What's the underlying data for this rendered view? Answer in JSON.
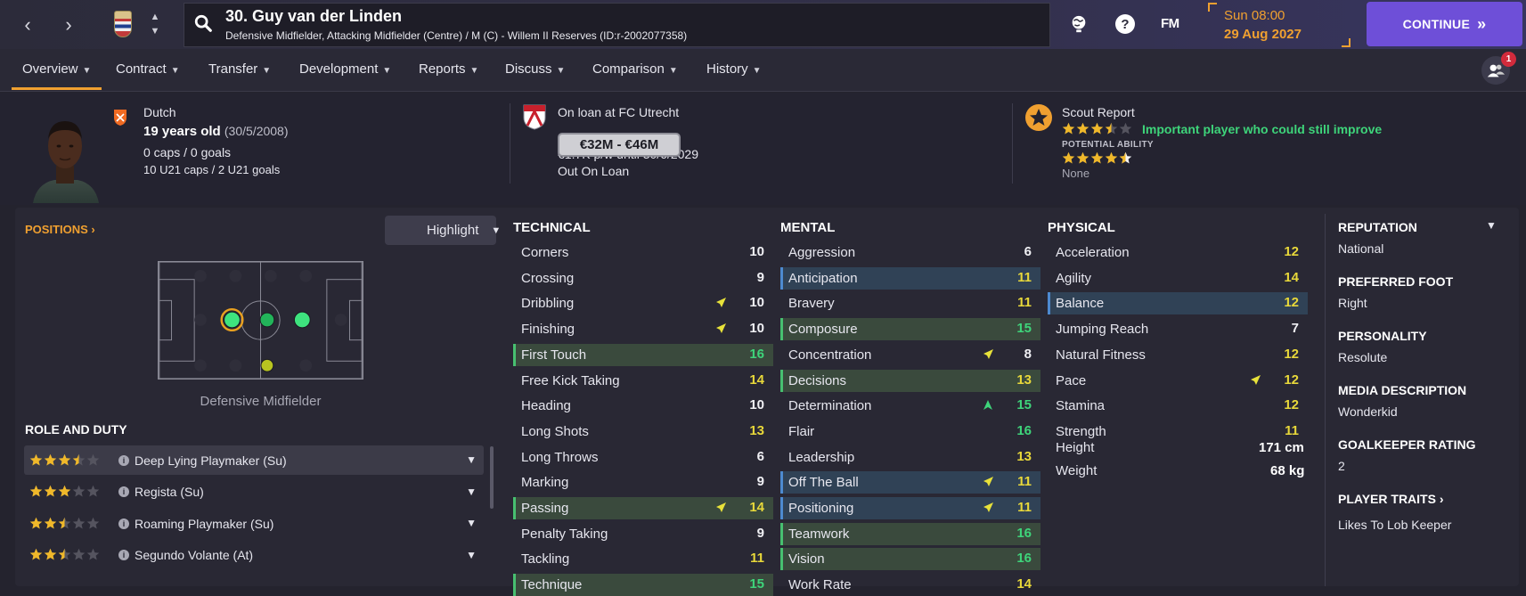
{
  "player": {
    "title": "30. Guy van der Linden",
    "subtitle": "Defensive Midfielder, Attacking Midfielder (Centre) / M (C) - Willem II Reserves (ID:r-2002077358)"
  },
  "topbar": {
    "fm_label": "FM",
    "date_day": "Sun 08:00",
    "date_full": "29 Aug 2027",
    "continue_label": "CONTINUE",
    "accent": "#f0a030",
    "continue_color": "#6e4fd8"
  },
  "tabs": [
    {
      "label": "Overview",
      "active": true
    },
    {
      "label": "Contract"
    },
    {
      "label": "Transfer"
    },
    {
      "label": "Development"
    },
    {
      "label": "Reports"
    },
    {
      "label": "Discuss"
    },
    {
      "label": "Comparison"
    },
    {
      "label": "History"
    }
  ],
  "notifications": "1",
  "info": {
    "nationality": "Dutch",
    "age": "19 years old",
    "dob": "(30/5/2008)",
    "caps": "0 caps / 0 goals",
    "u21": "10 U21 caps / 2 U21 goals",
    "loan": "On loan at FC Utrecht",
    "value": "€32M - €46M",
    "wage": "€1.7K p/w until 30/6/2029",
    "status": "Out On Loan",
    "scout_title": "Scout Report",
    "scout_comment": "Important player who could still improve",
    "potential_label": "POTENTIAL ABILITY",
    "current_stars": 3.5,
    "potential_stars": 4.5,
    "potential_extra": "None"
  },
  "positions": {
    "title": "POSITIONS",
    "highlight_label": "Highlight",
    "position_label": "Defensive Midfielder"
  },
  "roles": {
    "title": "ROLE AND DUTY",
    "items": [
      {
        "name": "Deep Lying Playmaker (Su)",
        "stars": 3.5
      },
      {
        "name": "Regista (Su)",
        "stars": 3
      },
      {
        "name": "Roaming Playmaker (Su)",
        "stars": 2.5
      },
      {
        "name": "Segundo Volante (At)",
        "stars": 2.5
      }
    ]
  },
  "technical": {
    "title": "TECHNICAL",
    "items": [
      {
        "name": "Corners",
        "value": "10"
      },
      {
        "name": "Crossing",
        "value": "9"
      },
      {
        "name": "Dribbling",
        "value": "10",
        "arrow": "up-right"
      },
      {
        "name": "Finishing",
        "value": "10",
        "arrow": "up-right"
      },
      {
        "name": "First Touch",
        "value": "16",
        "hl": "green"
      },
      {
        "name": "Free Kick Taking",
        "value": "14"
      },
      {
        "name": "Heading",
        "value": "10"
      },
      {
        "name": "Long Shots",
        "value": "13"
      },
      {
        "name": "Long Throws",
        "value": "6"
      },
      {
        "name": "Marking",
        "value": "9"
      },
      {
        "name": "Passing",
        "value": "14",
        "hl": "green",
        "arrow": "up-right"
      },
      {
        "name": "Penalty Taking",
        "value": "9"
      },
      {
        "name": "Tackling",
        "value": "11"
      },
      {
        "name": "Technique",
        "value": "15",
        "hl": "green"
      }
    ]
  },
  "mental": {
    "title": "MENTAL",
    "items": [
      {
        "name": "Aggression",
        "value": "6"
      },
      {
        "name": "Anticipation",
        "value": "11",
        "hl": "blue"
      },
      {
        "name": "Bravery",
        "value": "11"
      },
      {
        "name": "Composure",
        "value": "15",
        "hl": "green"
      },
      {
        "name": "Concentration",
        "value": "8",
        "arrow": "up-right"
      },
      {
        "name": "Decisions",
        "value": "13",
        "hl": "green"
      },
      {
        "name": "Determination",
        "value": "15",
        "arrow": "up"
      },
      {
        "name": "Flair",
        "value": "16"
      },
      {
        "name": "Leadership",
        "value": "13"
      },
      {
        "name": "Off The Ball",
        "value": "11",
        "hl": "blue",
        "arrow": "up-right"
      },
      {
        "name": "Positioning",
        "value": "11",
        "hl": "blue",
        "arrow": "up-right"
      },
      {
        "name": "Teamwork",
        "value": "16",
        "hl": "green"
      },
      {
        "name": "Vision",
        "value": "16",
        "hl": "green"
      },
      {
        "name": "Work Rate",
        "value": "14"
      }
    ]
  },
  "physical": {
    "title": "PHYSICAL",
    "items": [
      {
        "name": "Acceleration",
        "value": "12"
      },
      {
        "name": "Agility",
        "value": "14"
      },
      {
        "name": "Balance",
        "value": "12",
        "hl": "blue"
      },
      {
        "name": "Jumping Reach",
        "value": "7"
      },
      {
        "name": "Natural Fitness",
        "value": "12"
      },
      {
        "name": "Pace",
        "value": "12",
        "arrow": "up-right"
      },
      {
        "name": "Stamina",
        "value": "12"
      },
      {
        "name": "Strength",
        "value": "11"
      }
    ],
    "height_label": "Height",
    "height": "171 cm",
    "weight_label": "Weight",
    "weight": "68 kg"
  },
  "profile": {
    "reputation_label": "REPUTATION",
    "reputation": "National",
    "foot_label": "PREFERRED FOOT",
    "foot": "Right",
    "personality_label": "PERSONALITY",
    "personality": "Resolute",
    "media_label": "MEDIA DESCRIPTION",
    "media": "Wonderkid",
    "gk_label": "GOALKEEPER RATING",
    "gk": "2",
    "traits_label": "PLAYER TRAITS",
    "traits": "Likes To Lob Keeper"
  }
}
